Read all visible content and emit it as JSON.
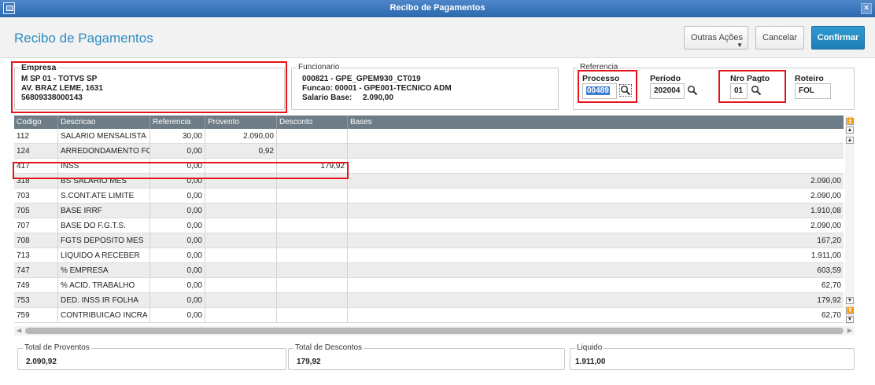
{
  "window": {
    "title": "Recibo de Pagamentos"
  },
  "header": {
    "title": "Recibo de Pagamentos",
    "buttons": {
      "outras": "Outras Ações",
      "cancelar": "Cancelar",
      "confirmar": "Confirmar"
    }
  },
  "empresa": {
    "legend": "Empresa",
    "line1": "M SP 01  - TOTVS SP",
    "line2": "AV. BRAZ LEME, 1631",
    "line3": "56809338000143"
  },
  "funcionario": {
    "legend": "Funcionario",
    "line1": "000821 - GPE_GPEM930_CT019",
    "line2": "Funcao: 00001 - GPE001-TECNICO ADM",
    "salario_label": "Salario Base:",
    "salario_value": "2.090,00"
  },
  "referencia": {
    "legend": "Referencia",
    "processo": {
      "label": "Processo",
      "value": "00489"
    },
    "periodo": {
      "label": "Período",
      "value": "202004"
    },
    "nro_pagto": {
      "label": "Nro Pagto",
      "value": "01"
    },
    "roteiro": {
      "label": "Roteiro",
      "value": "FOL"
    }
  },
  "grid": {
    "columns": [
      "Codigo",
      "Descricao",
      "Referencia",
      "Provento",
      "Desconto",
      "Bases"
    ],
    "rows": [
      [
        "112",
        "SALARIO MENSALISTA",
        "30,00",
        "2.090,00",
        "",
        ""
      ],
      [
        "124",
        "ARREDONDAMENTO FOLHA",
        "0,00",
        "0,92",
        "",
        ""
      ],
      [
        "417",
        "INSS",
        "0,00",
        "",
        "179,92",
        ""
      ],
      [
        "318",
        "BS SALARIO MES",
        "0,00",
        "",
        "",
        "2.090,00"
      ],
      [
        "703",
        "S.CONT.ATE LIMITE",
        "0,00",
        "",
        "",
        "2.090,00"
      ],
      [
        "705",
        "BASE IRRF",
        "0,00",
        "",
        "",
        "1.910,08"
      ],
      [
        "707",
        "BASE DO F.G.T.S.",
        "0,00",
        "",
        "",
        "2.090,00"
      ],
      [
        "708",
        "FGTS DEPOSITO MES",
        "0,00",
        "",
        "",
        "167,20"
      ],
      [
        "713",
        "LIQUIDO A RECEBER",
        "0,00",
        "",
        "",
        "1.911,00"
      ],
      [
        "747",
        "% EMPRESA",
        "0,00",
        "",
        "",
        "603,59"
      ],
      [
        "749",
        "% ACID. TRABALHO",
        "0,00",
        "",
        "",
        "62,70"
      ],
      [
        "753",
        "DED. INSS IR FOLHA",
        "0,00",
        "",
        "",
        "179,92"
      ],
      [
        "759",
        "CONTRIBUICAO INCRA",
        "0,00",
        "",
        "",
        "62,70"
      ]
    ]
  },
  "totals": {
    "proventos": {
      "label": "Total de Proventos",
      "value": "2.090,92"
    },
    "descontos": {
      "label": "Total de Descontos",
      "value": "179,92"
    },
    "liquido": {
      "label": "Liquido",
      "value": "1.911,00"
    }
  },
  "icons": {
    "app": "window-icon",
    "close": "close-icon",
    "search": "magnifier-icon",
    "scroll_top": "double-chevron-up-icon",
    "scroll_up": "chevron-up-icon",
    "scroll_down": "chevron-down-icon",
    "scroll_bottom": "double-chevron-down-icon"
  },
  "colors": {
    "titlebar": "#2b68ae",
    "accent": "#2e8cbf",
    "confirm": "#1f7fb6",
    "highlight": "#e5141a",
    "grid_header": "#6d7c86"
  }
}
